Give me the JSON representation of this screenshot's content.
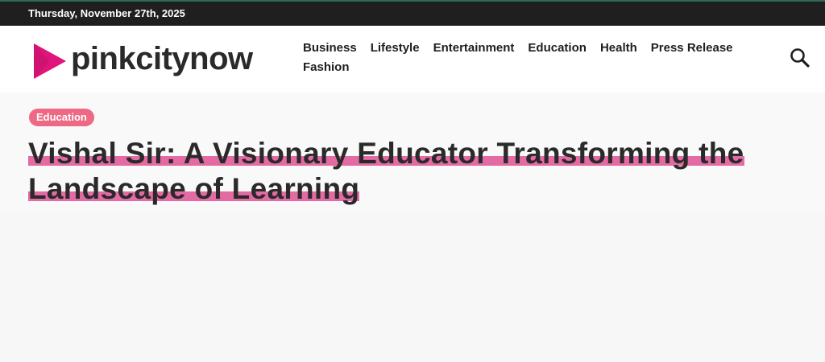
{
  "topbar": {
    "date": "Thursday, November 27th, 2025"
  },
  "header": {
    "logo_text": "pinkcitynow",
    "nav": [
      "Business",
      "Lifestyle",
      "Entertainment",
      "Education",
      "Health",
      "Press Release",
      "Fashion"
    ],
    "search_icon": "search-icon"
  },
  "article": {
    "category": "Education",
    "title": "Vishal Sir: A Visionary Educator Transforming the Landscape of Learning"
  },
  "colors": {
    "topbar_bg": "#1f1f1f",
    "badge_bg": "#ee6a84",
    "title_highlight": "#e36aa3",
    "logo_magenta": "#e0147a"
  }
}
